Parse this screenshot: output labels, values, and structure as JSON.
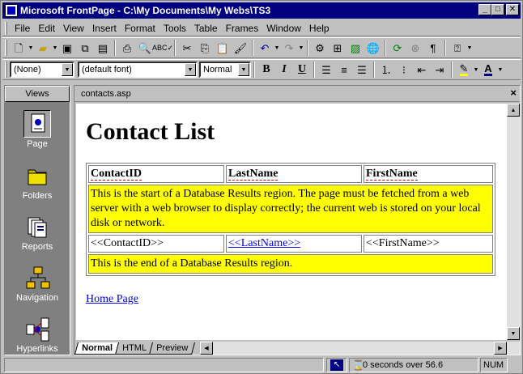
{
  "window": {
    "title": "Microsoft FrontPage - C:\\My Documents\\My Webs\\TS3",
    "minimize": "_",
    "maximize": "□",
    "close": "✕"
  },
  "menu": [
    "File",
    "Edit",
    "View",
    "Insert",
    "Format",
    "Tools",
    "Table",
    "Frames",
    "Window",
    "Help"
  ],
  "format_toolbar": {
    "style_value": "(None)",
    "font_value": "(default font)",
    "size_value": "Normal",
    "bold": "B",
    "italic": "I",
    "underline": "U"
  },
  "views_panel": {
    "title": "Views",
    "items": [
      "Page",
      "Folders",
      "Reports",
      "Navigation",
      "Hyperlinks"
    ],
    "active": "Page"
  },
  "document": {
    "tab": "contacts.asp",
    "close": "×",
    "heading": "Contact List",
    "table": {
      "headers": [
        "ContactID",
        "LastName",
        "FirstName"
      ],
      "start_notice": "This is the start of a Database Results region. The page must be fetched from a web server with a web browser to display correctly; the current web is stored on your local disk or network.",
      "row": [
        "<<ContactID>>",
        "<<LastName>>",
        "<<FirstName>>"
      ],
      "end_notice": "This is the end of a Database Results region."
    },
    "home_link": "Home Page",
    "view_tabs": [
      "Normal",
      "HTML",
      "Preview"
    ],
    "active_view_tab": "Normal"
  },
  "status": {
    "download_time": "0 seconds over 56.6",
    "num": "NUM"
  },
  "colors": {
    "titlebar": "#000080",
    "highlight": "#ffff00",
    "link": "#0000ee",
    "chrome": "#c0c0c0"
  }
}
